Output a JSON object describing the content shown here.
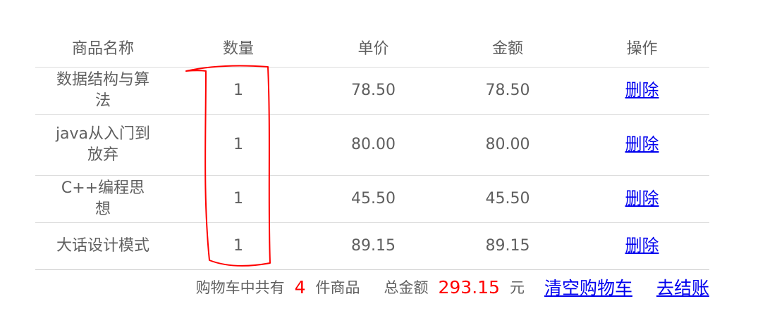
{
  "table": {
    "headers": [
      "商品名称",
      "数量",
      "单价",
      "金额",
      "操作"
    ],
    "rows": [
      {
        "name": "数据结构与算法",
        "qty": "1",
        "price": "78.50",
        "amount": "78.50",
        "action": "删除"
      },
      {
        "name": "java从入门到放弃",
        "qty": "1",
        "price": "80.00",
        "amount": "80.00",
        "action": "删除"
      },
      {
        "name": "C++编程思想",
        "qty": "1",
        "price": "45.50",
        "amount": "45.50",
        "action": "删除"
      },
      {
        "name": "大话设计模式",
        "qty": "1",
        "price": "89.15",
        "amount": "89.15",
        "action": "删除"
      }
    ]
  },
  "summary": {
    "count_prefix": "购物车中共有",
    "count": "4",
    "count_suffix": "件商品",
    "total_label": "总金额",
    "total": "293.15",
    "currency": "元",
    "clear_label": "清空购物车",
    "checkout_label": "去结账"
  },
  "colors": {
    "highlight": "#ff0000",
    "link": "#0000ee",
    "text": "#5f5f5f"
  },
  "annotation": {
    "shape": "hand-drawn red outline around quantity column"
  }
}
